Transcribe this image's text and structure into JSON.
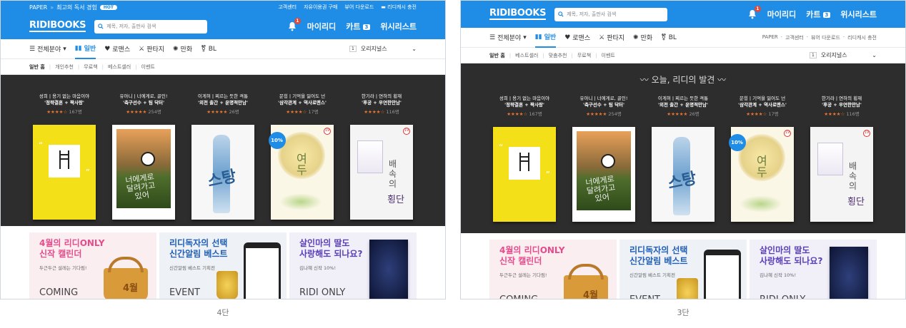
{
  "colors": {
    "brand": "#1f8ce6",
    "dark_bg": "#2d2d2d",
    "star": "#e9752d"
  },
  "util_bar": {
    "paper": "PAPER",
    "promo": "최고의 독서 경험",
    "hot": "HOT",
    "links": [
      "고객센터",
      "자유이용권 구매",
      "뷰어 다운로드",
      "리디캐시 충전"
    ]
  },
  "header": {
    "logo": "RIDIBOOKS",
    "search_placeholder": "제목, 저자, 출판사 검색",
    "bell_badge": "1",
    "my_ridi": "마이리디",
    "cart": "카트",
    "cart_count": "3",
    "wishlist": "위시리스트"
  },
  "gnb": {
    "all": "전체분야",
    "tabs": [
      "일반",
      "로맨스",
      "판타지",
      "만화",
      "BL"
    ],
    "sort_num": "1",
    "sort_label": "오리지널스",
    "extra_links": [
      "PAPER",
      "고객센터",
      "뷰어 다운로드",
      "리디캐시 충전"
    ]
  },
  "sub_nav_4": [
    "일반 홈",
    "개인추천",
    "무료책",
    "베스트셀러",
    "이벤트"
  ],
  "sub_nav_3": [
    "일반 홈",
    "베스트셀러",
    "맞춤추천",
    "무료책",
    "이벤트"
  ],
  "section_title": "오늘, 리디의 발견",
  "books": [
    {
      "line1": "성희 | 용기 없는 마음이야",
      "line2": "'정략결혼 + 짝사랑'",
      "stars": "★★★★☆",
      "count": "167명"
    },
    {
      "line1": "유아니 | 너에게로, 골인!",
      "line2": "'축구선수 + 팀 닥터'",
      "stars": "★★★★★",
      "count": "254명"
    },
    {
      "line1": "이게혀 | 찌르는 듯한 격통",
      "line2": "'외전 출간 + 운명적만남'",
      "stars": "★★★★★",
      "count": "26명"
    },
    {
      "line1": "문힝 | 기억을 잃어도 넌",
      "line2": "'삼각관계 + 역사로맨스'",
      "stars": "★★★★☆",
      "count": "17명"
    },
    {
      "line1": "한기라 | 연하의 횡재",
      "line2": "'후궁 + 우연한만남'",
      "stars": "★★★★☆",
      "count": "116명"
    }
  ],
  "book_badges": {
    "discount": "10%",
    "adult": "19"
  },
  "banners": [
    {
      "title1": "4월의 리디ONLY",
      "title2": "신작 캘린더",
      "sub": "두근두근 설레는 기다림!",
      "foot": "COMING",
      "mark": "4월"
    },
    {
      "title1": "리디독자의 선택",
      "title2": "신간알림 베스트",
      "sub": "신간알림 베스트 기획전",
      "foot": "EVENT"
    },
    {
      "title1": "살인마의 딸도",
      "title2": "사랑해도 되나요?",
      "sub": "김나혜 신작 10%!",
      "foot": "RIDI ONLY"
    }
  ],
  "captions": {
    "left": "4단",
    "right": "3단"
  }
}
